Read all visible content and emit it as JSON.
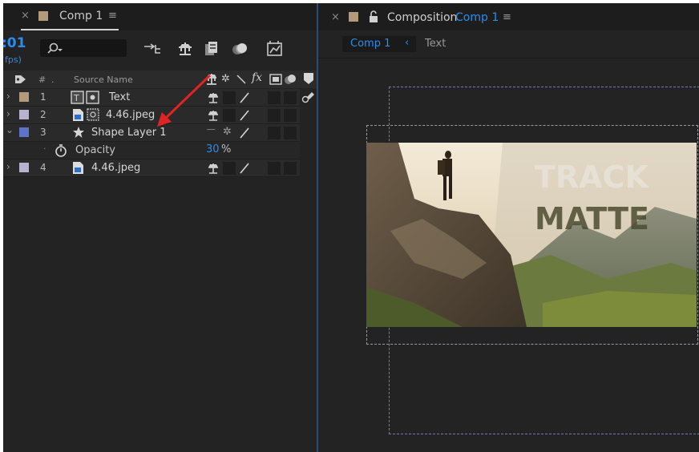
{
  "timeline": {
    "tab_title": "Comp 1",
    "timecode": ":01",
    "fps": "fps)",
    "column_headers": {
      "number": "#",
      "source_name": "Source Name",
      "fx": "fx"
    },
    "layers": [
      {
        "number": "1",
        "name": "Text",
        "label_color": "#b39a7a"
      },
      {
        "number": "2",
        "name": "4.46.jpeg",
        "label_color": "#b6b3cf"
      },
      {
        "number": "3",
        "name": "Shape Layer 1",
        "label_color": "#5f72c9"
      },
      {
        "number": "4",
        "name": "4.46.jpeg",
        "label_color": "#b6b3cf"
      }
    ],
    "opacity": {
      "label": "Opacity",
      "value": "30",
      "unit": "%"
    }
  },
  "viewer": {
    "panel_title": "Composition",
    "comp_name": "Comp 1",
    "breadcrumb": {
      "active": "Comp 1",
      "next": "Text"
    },
    "image_text_line1": "TRACK",
    "image_text_line2": "MATTE"
  },
  "colors": {
    "accent_blue": "#2d8ceb",
    "panel_bg": "#232323",
    "arrow_red": "#e02424",
    "comp_swatch": "#b39a7a"
  },
  "icons": [
    "close-icon",
    "menu-icon",
    "search-icon",
    "lock-icon",
    "star-icon",
    "stopwatch-icon",
    "pen-icon",
    "chevron-right-icon",
    "chevron-down-icon"
  ]
}
